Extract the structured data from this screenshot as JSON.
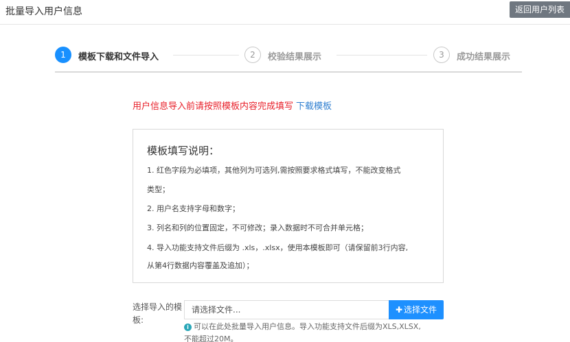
{
  "header": {
    "title": "批量导入用户信息",
    "back_button": "返回用户列表"
  },
  "steps": [
    {
      "number": "1",
      "label": "模板下载和文件导入",
      "state": "active"
    },
    {
      "number": "2",
      "label": "校验结果展示",
      "state": "pending"
    },
    {
      "number": "3",
      "label": "成功结果展示",
      "state": "pending"
    }
  ],
  "notice": {
    "text": "用户信息导入前请按照模板内容完成填写",
    "link": "下载模板"
  },
  "instructions": {
    "title": "模板填写说明：",
    "lines": [
      "1. 红色字段为必填项，其他列为可选列,需按照要求格式填写，不能改变格式",
      "类型；",
      "2. 用户名支持字母和数字；",
      "3. 列名和列的位置固定，不可修改；录入数据时不可合并单元格；",
      "4. 导入功能支持文件后缀为 .xls，.xlsx，使用本模板即可（请保留前3行内容,",
      "从第4行数据内容覆盖及追加）；"
    ]
  },
  "upload": {
    "label_line1": "选择导入的模",
    "label_line2": "板:",
    "input_placeholder": "请选择文件...",
    "button": "选择文件",
    "hint_line1": "可以在此处批量导入用户信息。导入功能支持文件后缀为XLS,XLSX,",
    "hint_line2": "不能超过20M。"
  },
  "colors": {
    "primary": "#1890ff",
    "required_red": "#e8202a",
    "link_blue": "#2f7fd0",
    "back_button_bg": "#6f7780"
  },
  "icons": {
    "plus": "plus-icon",
    "info": "info-circle-icon"
  }
}
